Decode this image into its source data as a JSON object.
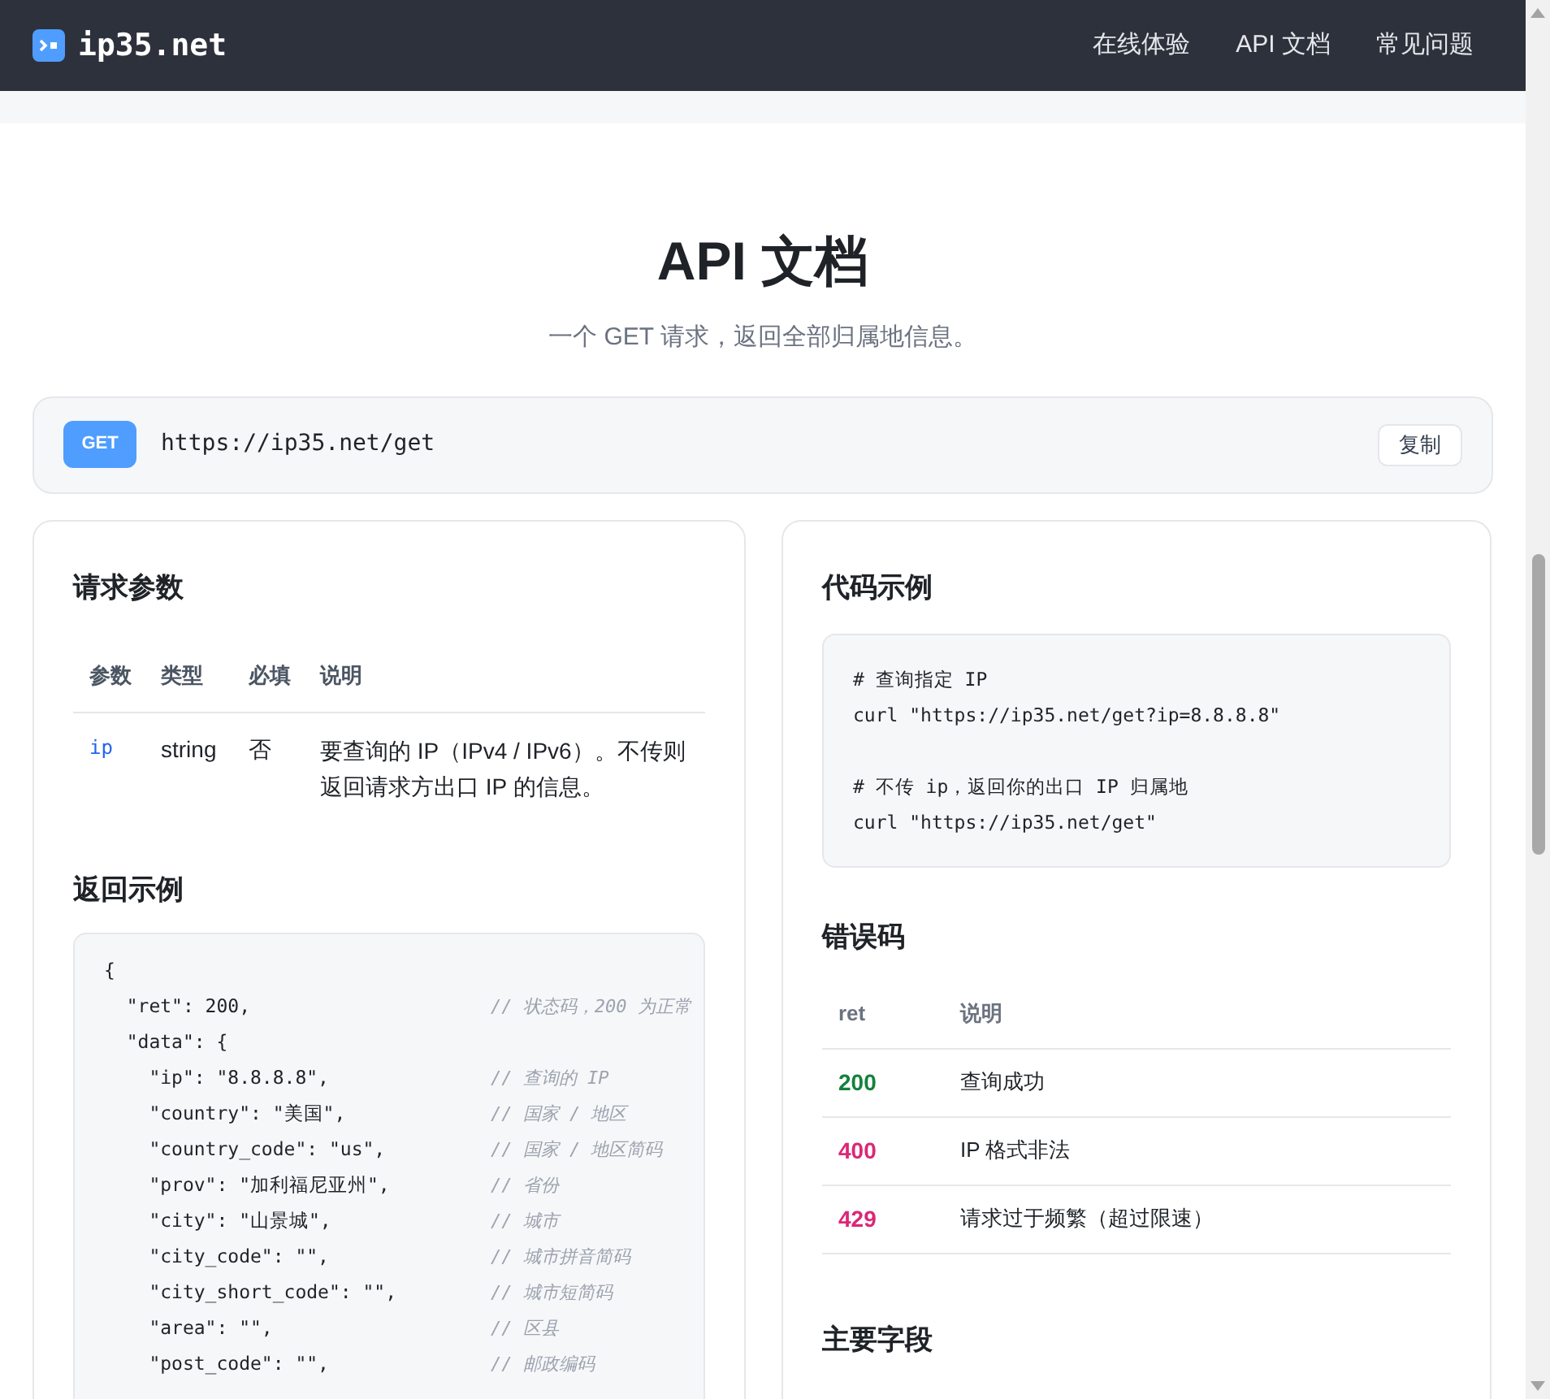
{
  "header": {
    "logo_text": "ip35.net",
    "nav": [
      {
        "label": "在线体验"
      },
      {
        "label": "API 文档"
      },
      {
        "label": "常见问题"
      }
    ]
  },
  "hero": {
    "title": "API 文档",
    "subtitle": "一个 GET 请求，返回全部归属地信息。"
  },
  "endpoint": {
    "method": "GET",
    "url": "https://ip35.net/get",
    "copy_button": "复制"
  },
  "params": {
    "title": "请求参数",
    "columns": [
      "参数",
      "类型",
      "必填",
      "说明"
    ],
    "rows": [
      {
        "name": "ip",
        "type": "string",
        "required": "否",
        "description": "要查询的 IP（IPv4 / IPv6）。不传则返回请求方出口 IP 的信息。"
      }
    ]
  },
  "response_example": {
    "title": "返回示例",
    "lines": [
      {
        "code": "{"
      },
      {
        "code": "  \"ret\": 200,",
        "comment": "// 状态码，200 为正常"
      },
      {
        "code": "  \"data\": {"
      },
      {
        "code": "    \"ip\": \"8.8.8.8\",",
        "comment": "// 查询的 IP"
      },
      {
        "code": "    \"country\": \"美国\",",
        "comment": "// 国家 / 地区"
      },
      {
        "code": "    \"country_code\": \"us\",",
        "comment": "// 国家 / 地区简码"
      },
      {
        "code": "    \"prov\": \"加利福尼亚州\",",
        "comment": "// 省份"
      },
      {
        "code": "    \"city\": \"山景城\",",
        "comment": "// 城市"
      },
      {
        "code": "    \"city_code\": \"\",",
        "comment": "// 城市拼音简码"
      },
      {
        "code": "    \"city_short_code\": \"\",",
        "comment": "// 城市短简码"
      },
      {
        "code": "    \"area\": \"\",",
        "comment": "// 区县"
      },
      {
        "code": "    \"post_code\": \"\",",
        "comment": "// 邮政编码"
      }
    ]
  },
  "code_example": {
    "title": "代码示例",
    "blocks": [
      {
        "comment": "# 查询指定 IP",
        "command": "curl \"https://ip35.net/get?ip=8.8.8.8\""
      },
      {
        "comment": "# 不传 ip，返回你的出口 IP 归属地",
        "command": "curl \"https://ip35.net/get\""
      }
    ]
  },
  "error_codes": {
    "title": "错误码",
    "columns": [
      "ret",
      "说明"
    ],
    "rows": [
      {
        "ret": "200",
        "description": "查询成功",
        "color": "#15803d"
      },
      {
        "ret": "400",
        "description": "IP 格式非法",
        "color": "#db2777"
      },
      {
        "ret": "429",
        "description": "请求过于频繁（超过限速）",
        "color": "#db2777"
      }
    ]
  },
  "main_fields": {
    "title": "主要字段"
  }
}
